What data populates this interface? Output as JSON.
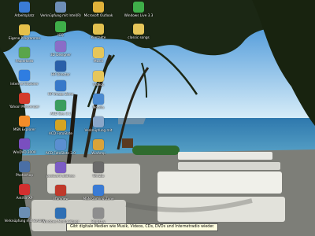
{
  "desktop": {
    "icons": [
      {
        "label": "Arbeitsplatz",
        "name": "my-computer-icon",
        "color": "#3a7bd5"
      },
      {
        "label": "Eigene Programme",
        "name": "programs-folder-icon",
        "color": "#e6c04a"
      },
      {
        "label": "Papierkorb",
        "name": "recycle-bin-icon",
        "color": "#5aa54b"
      },
      {
        "label": "Internet Explorer",
        "name": "internet-explorer-icon",
        "color": "#2f7de1"
      },
      {
        "label": "Yahoo! Messenger",
        "name": "yahoo-messenger-icon",
        "color": "#d33b2c"
      },
      {
        "label": "MSN Explorer",
        "name": "msn-explorer-icon",
        "color": "#f28c28"
      },
      {
        "label": "WinDVD 2000",
        "name": "windvd-icon",
        "color": "#7a4fbf"
      },
      {
        "label": "Photoshop",
        "name": "photoshop-icon",
        "color": "#4a6fa5"
      },
      {
        "label": "AntiVir XP",
        "name": "antivir-icon",
        "color": "#d32f2f"
      },
      {
        "label": "Verknüpfung mit Spybot",
        "name": "spybot-icon",
        "color": "#6b8fb3"
      },
      {
        "label": "Verknüpfung mit Intel(R)",
        "name": "intel-shortcut-icon",
        "color": "#6e8fb8"
      },
      {
        "label": "ICQ",
        "name": "icq-icon",
        "color": "#3fae49"
      },
      {
        "label": "3D Designer",
        "name": "3d-designer-icon",
        "color": "#8a6dc7"
      },
      {
        "label": "HP Director",
        "name": "hp-director-icon",
        "color": "#2a5fa8"
      },
      {
        "label": "HP Image Zone",
        "name": "hp-image-zone-icon",
        "color": "#3778c9"
      },
      {
        "label": "ACD See 3.1",
        "name": "acdsee-icon",
        "color": "#3a9d5d"
      },
      {
        "label": "ACD FotoSlate",
        "name": "acd-fotoslate-icon",
        "color": "#d4a422"
      },
      {
        "label": "ACD FotoSlate 3.0",
        "name": "acd-fotoslate-30-icon",
        "color": "#5b8fd1"
      },
      {
        "label": "postcard address",
        "name": "postcard-address-icon",
        "color": "#7c5cc4"
      },
      {
        "label": "IrfanView",
        "name": "irfanview-icon",
        "color": "#c0392b"
      },
      {
        "label": "Windows Media Player",
        "name": "windows-media-player-icon",
        "color": "#2f6fb4"
      },
      {
        "label": "Microsoft Outlook",
        "name": "microsoft-outlook-icon",
        "color": "#e0b23a"
      },
      {
        "label": "Kontakte",
        "name": "contacts-folder-icon",
        "color": "#e2c04f"
      },
      {
        "label": "Musik",
        "name": "music-folder-icon",
        "color": "#e6c65a"
      },
      {
        "label": "Videos",
        "name": "videos-folder-icon",
        "color": "#e6c65a"
      },
      {
        "label": "Mozilla",
        "name": "mozilla-icon",
        "color": "#4a8ad0"
      },
      {
        "label": "Verknüpfung mit",
        "name": "shortcut-icon",
        "color": "#8aa7c9"
      },
      {
        "label": "WinAmp",
        "name": "winamp-icon",
        "color": "#d9a33a"
      },
      {
        "label": "WinZip",
        "name": "winzip-icon",
        "color": "#6a6a6a"
      },
      {
        "label": "MSN Gaming Zone",
        "name": "msn-gaming-zone-icon",
        "color": "#3a7bd5"
      },
      {
        "label": "Registry",
        "name": "registry-icon",
        "color": "#8e8e8e"
      },
      {
        "label": "Windows Live 3.3",
        "name": "windows-live-icon",
        "color": "#3fae49"
      },
      {
        "label": "classic songs",
        "name": "classic-songs-folder-icon",
        "color": "#e6c65a"
      }
    ],
    "tooltip": "Gibt digitale Medien wie Musik, Videos, CDs, DVDs und Internetradio wieder.",
    "colors": {
      "sky_top": "#3a8fd6",
      "sky_bottom": "#cfe6f5",
      "sea": "#2f7fb8",
      "foliage": "#1c2a16",
      "deck": "#8a8a86",
      "bench": "#e9e9e4"
    }
  }
}
